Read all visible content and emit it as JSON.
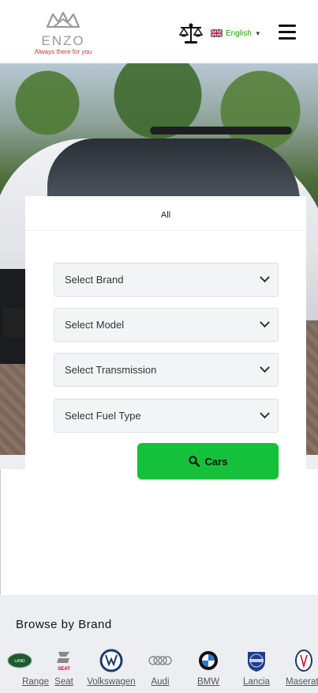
{
  "header": {
    "logo_word": "ENZO",
    "logo_tagline": "Always there for you",
    "language": "English",
    "icons": [
      "crown-logo-icon",
      "scale-compare-icon",
      "uk-flag-icon",
      "hamburger-menu-icon"
    ]
  },
  "search": {
    "tab_all": "All",
    "brand_select": "Select Brand",
    "model_select": "Select Model",
    "transmission_select": "Select Transmission",
    "fuel_select": "Select Fuel Type",
    "cars_button": "Cars"
  },
  "brands": {
    "title": "Browse by Brand",
    "items": [
      {
        "label": "Range"
      },
      {
        "label": "Seat"
      },
      {
        "label": "Volkswagen"
      },
      {
        "label": "Audi"
      },
      {
        "label": "BMW"
      },
      {
        "label": "Lancia"
      },
      {
        "label": "Maserati"
      }
    ]
  },
  "colors": {
    "accent_green": "#14c13a",
    "language_green": "#18a000",
    "logo_red": "#c0392b",
    "brand_bg": "#eceef2"
  }
}
